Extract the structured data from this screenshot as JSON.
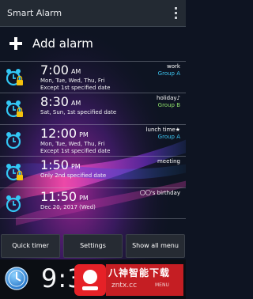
{
  "app": {
    "title": "Smart Alarm"
  },
  "add_alarm": {
    "label": "Add alarm"
  },
  "alarms": [
    {
      "time": "7:00",
      "ampm": "AM",
      "days": "Mon, Tue, Wed, Thu, Fri",
      "extra": "Except 1st specified date",
      "name": "work",
      "group": "Group A",
      "icon": "alarm-clock-locked-icon"
    },
    {
      "time": "8:30",
      "ampm": "AM",
      "days": "Sat, Sun, 1st specified date",
      "extra": "",
      "name": "holiday♪",
      "group": "Group B",
      "icon": "alarm-clock-locked-icon"
    },
    {
      "time": "12:00",
      "ampm": "PM",
      "days": "Mon, Tue, Wed, Thu, Fri",
      "extra": "Except 1st specified date",
      "name": "lunch time★",
      "group": "Group A",
      "icon": "alarm-clock-icon"
    },
    {
      "time": "1:50",
      "ampm": "PM",
      "days": "Only 2nd specified date",
      "extra": "",
      "name": "meeting",
      "group": "",
      "icon": "alarm-clock-locked-icon"
    },
    {
      "time": "11:50",
      "ampm": "PM",
      "days": "Dec 20, 2017 (Wed)",
      "extra": "",
      "name": "〇〇's birthday",
      "group": "",
      "icon": "alarm-clock-icon"
    }
  ],
  "buttons": {
    "quick_timer": "Quick timer",
    "settings": "Settings",
    "show_all_menu": "Show all menu"
  },
  "footer": {
    "current_time": "9:3",
    "watermark_text": "八神智能下载",
    "watermark_url": "zntx.cc",
    "menu_label": "MENU"
  },
  "colors": {
    "group_a": "#3dc4ef",
    "group_b": "#8ee06a",
    "accent_pink": "#e0317f",
    "accent_purple": "#8a2fd6",
    "watermark_red": "#e62127"
  }
}
